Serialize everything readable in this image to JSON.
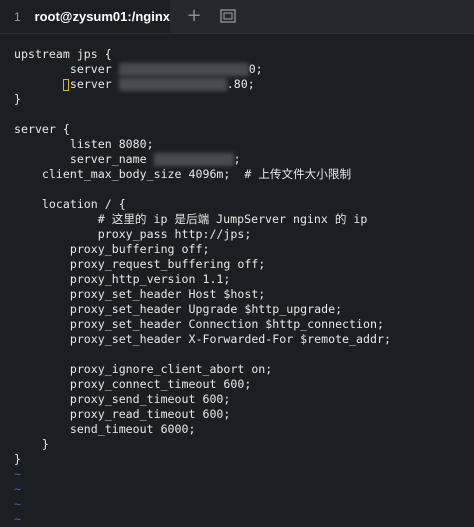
{
  "tab": {
    "number": "1",
    "title": "root@zysum01:/nginx"
  },
  "icons": {
    "add_tab": "plus-icon",
    "window": "window-icon"
  },
  "code": {
    "l01": "upstream jps {",
    "l02a": "        server ",
    "l02b": "0;",
    "l03a": "server ",
    "l03b": ".80;",
    "l04": "}",
    "l06": "server {",
    "l07": "        listen 8080;",
    "l08a": "        server_name ",
    "l08b": ";",
    "l09": "    client_max_body_size 4096m;  # 上传文件大小限制",
    "l11": "    location / {",
    "l12": "            # 这里的 ip 是后端 JumpServer nginx 的 ip",
    "l13": "            proxy_pass http://jps;",
    "l14": "        proxy_buffering off;",
    "l15": "        proxy_request_buffering off;",
    "l16": "        proxy_http_version 1.1;",
    "l17": "        proxy_set_header Host $host;",
    "l18": "        proxy_set_header Upgrade $http_upgrade;",
    "l19": "        proxy_set_header Connection $http_connection;",
    "l20": "        proxy_set_header X-Forwarded-For $remote_addr;",
    "l22": "        proxy_ignore_client_abort on;",
    "l23": "        proxy_connect_timeout 600;",
    "l24": "        proxy_send_timeout 600;",
    "l25": "        proxy_read_timeout 600;",
    "l26": "        send_timeout 6000;",
    "l27": "    }",
    "l28": "}",
    "tilde": "~"
  },
  "colors": {
    "background": "#1b1f23",
    "text": "#e8e8e8",
    "tilde": "#2f6fb0",
    "cursor": "#d8b23a"
  }
}
